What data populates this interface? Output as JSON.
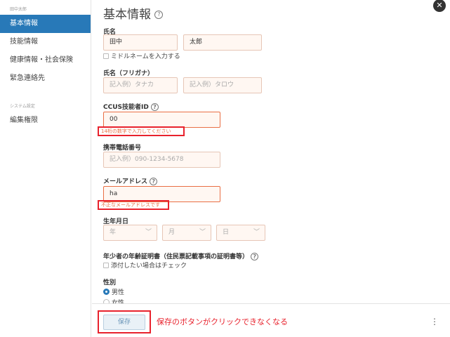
{
  "sidebar": {
    "group1": "田中太郎",
    "items1": [
      "基本情報",
      "技能情報",
      "健康情報・社会保険",
      "緊急連絡先"
    ],
    "group2": "システム設定",
    "items2": [
      "編集権限"
    ]
  },
  "title": "基本情報",
  "form": {
    "name_label": "氏名",
    "last_name": "田中",
    "first_name": "太郎",
    "middle_check": "ミドルネームを入力する",
    "kana_label": "氏名（フリガナ）",
    "kana_last_ph": "記入例）タナカ",
    "kana_first_ph": "記入例）タロウ",
    "ccus_label": "CCUS技能者ID",
    "ccus_value": "00",
    "ccus_error": "14桁の数字で入力してください",
    "phone_label": "携帯電話番号",
    "phone_ph": "記入例）090-1234-5678",
    "email_label": "メールアドレス",
    "email_value": "ha",
    "email_error": "不正なメールアドレスです",
    "birth_label": "生年月日",
    "year_ph": "年",
    "month_ph": "月",
    "day_ph": "日",
    "minor_label": "年少者の年齢証明書（住民票記載事項の証明書等）",
    "minor_check": "添付したい場合はチェック",
    "gender_label": "性別",
    "gender_male": "男性",
    "gender_female": "女性",
    "gender_selected": "男性"
  },
  "footer": {
    "save_label": "保存",
    "annotation": "保存のボタンがクリックできなくなる"
  },
  "colors": {
    "accent": "#2879b8",
    "error": "#e8222d",
    "field_bg": "#fff7f2"
  },
  "icons": [
    "help-icon",
    "close-icon",
    "chevron-down-icon",
    "more-vertical-icon"
  ]
}
